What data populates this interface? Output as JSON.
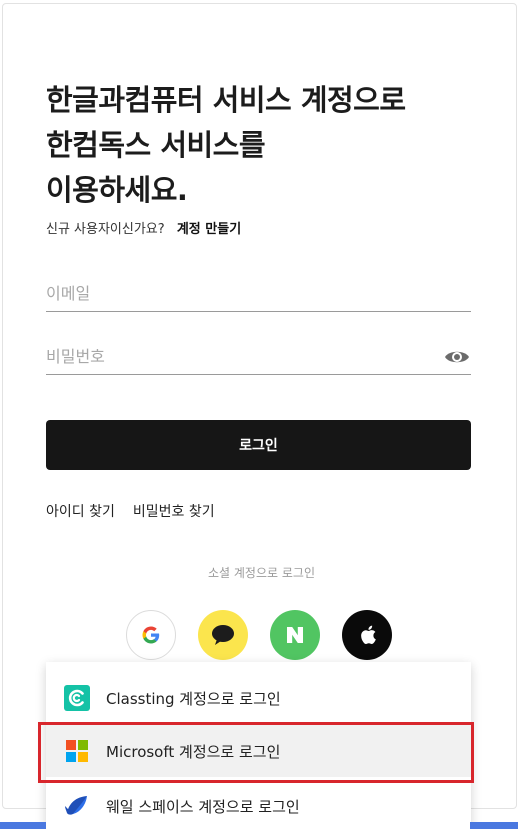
{
  "title": {
    "line1": "한글과컴퓨터 서비스 계정으로",
    "line2": "한컴독스 서비스를",
    "line3": "이용하세요."
  },
  "signup": {
    "question": "신규 사용자이신가요?",
    "link": "계정 만들기"
  },
  "form": {
    "email_placeholder": "이메일",
    "email_value": "",
    "password_placeholder": "비밀번호",
    "password_value": "",
    "password_toggle_icon": "eye-icon",
    "login_label": "로그인"
  },
  "find": {
    "find_id": "아이디 찾기",
    "find_password": "비밀번호 찾기"
  },
  "social": {
    "label": "소셜 계정으로 로그인",
    "buttons": [
      {
        "name": "google",
        "icon": "google-icon"
      },
      {
        "name": "kakao",
        "icon": "kakao-speech-bubble-icon"
      },
      {
        "name": "naver",
        "icon": "naver-n-icon"
      },
      {
        "name": "apple",
        "icon": "apple-icon"
      }
    ]
  },
  "dropdown": {
    "items": [
      {
        "label": "Classting 계정으로 로그인",
        "icon": "classting-icon"
      },
      {
        "label": "Microsoft 계정으로 로그인",
        "icon": "microsoft-icon",
        "highlighted": true
      },
      {
        "label": "웨일 스페이스 계정으로 로그인",
        "icon": "whale-icon"
      }
    ]
  },
  "colors": {
    "login_button": "#161616",
    "kakao": "#fbe54d",
    "naver": "#51c562",
    "apple": "#0a0a0a",
    "classting": "#14c2a6",
    "highlight": "#d8262c",
    "bottom_strip": "#4a78e0"
  }
}
